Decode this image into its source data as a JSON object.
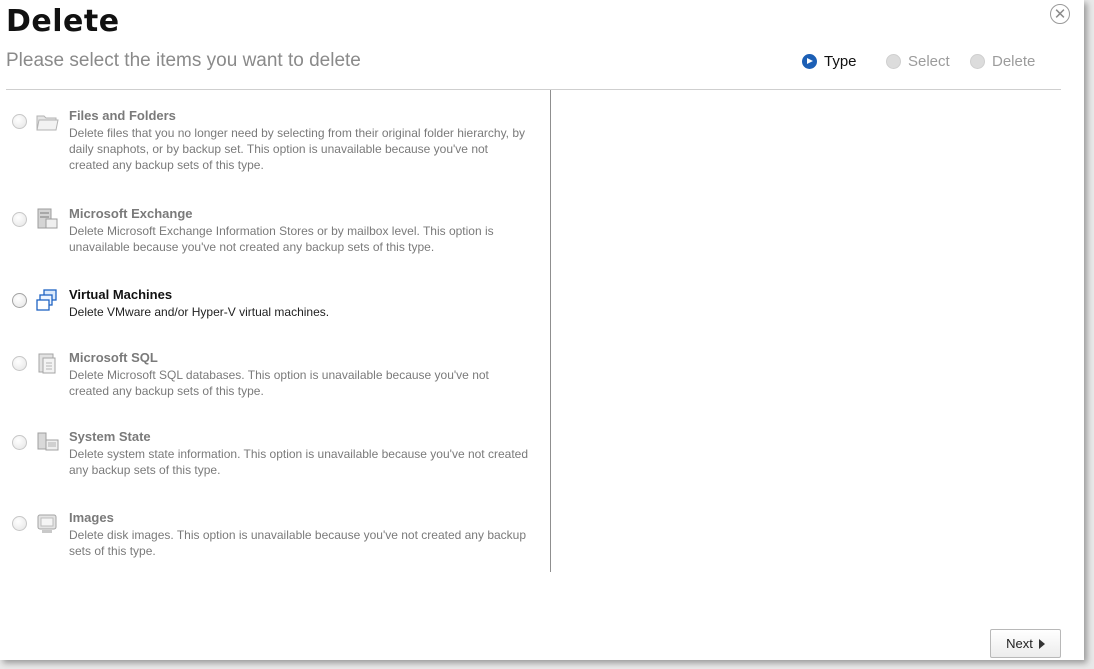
{
  "dialog": {
    "title": "Delete",
    "subtitle": "Please select the items you want to delete",
    "close_glyph": "✕"
  },
  "steps": [
    {
      "label": "Type",
      "state": "active"
    },
    {
      "label": "Select",
      "state": "inactive"
    },
    {
      "label": "Delete",
      "state": "inactive"
    }
  ],
  "options": [
    {
      "title": "Files and Folders",
      "description": "Delete files that you no longer need by selecting from their original folder hierarchy, by daily snaphots, or by backup set. This option is unavailable because you've not created any backup sets of this type.",
      "icon": "folder-icon",
      "enabled": false
    },
    {
      "title": "Microsoft Exchange",
      "description": "Delete Microsoft Exchange Information Stores or by mailbox level. This option is unavailable because you've not created any backup sets of this type.",
      "icon": "exchange-server-icon",
      "enabled": false
    },
    {
      "title": "Virtual Machines",
      "description": "Delete VMware and/or Hyper-V virtual machines.",
      "icon": "virtual-machines-icon",
      "enabled": true
    },
    {
      "title": "Microsoft SQL",
      "description": "Delete Microsoft SQL databases. This option is unavailable because you've not created any backup sets of this type.",
      "icon": "sql-database-icon",
      "enabled": false
    },
    {
      "title": "System State",
      "description": "Delete system state information. This option is unavailable because you've not created any backup sets of this type.",
      "icon": "system-state-icon",
      "enabled": false
    },
    {
      "title": "Images",
      "description": "Delete disk images. This option is unavailable because you've not created any backup sets of this type.",
      "icon": "disk-image-icon",
      "enabled": false
    }
  ],
  "footer": {
    "next_label": "Next"
  },
  "colors": {
    "accent": "#1c5fb5",
    "disabled_text": "#7a7a7a"
  }
}
